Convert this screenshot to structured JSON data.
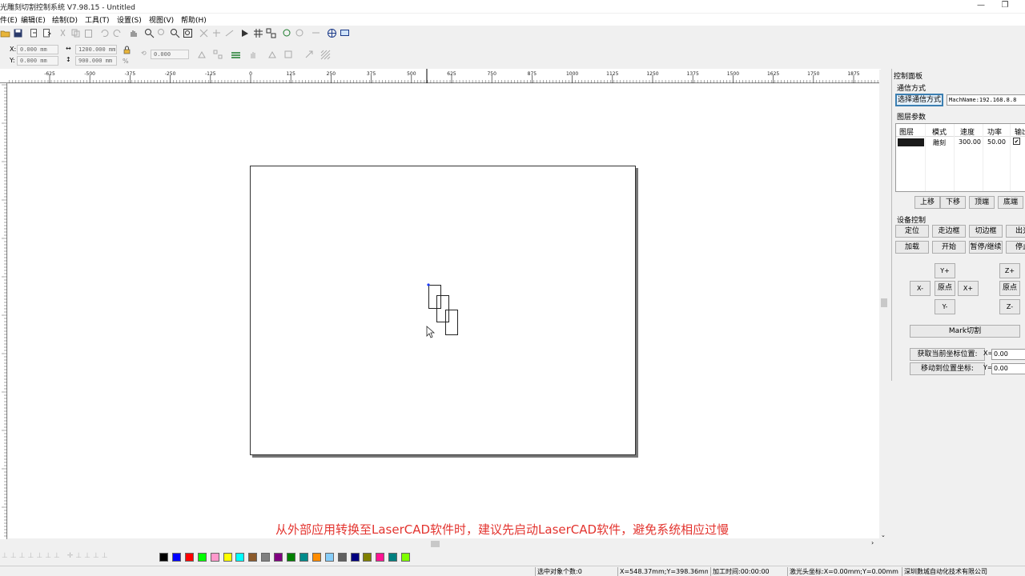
{
  "app": {
    "title": "光雕刻切割控制系统 V7.98.15 - Untitled",
    "win_minimize": "—",
    "win_restore": "❐"
  },
  "menu": [
    {
      "id": "file",
      "label": "件(E)"
    },
    {
      "id": "edit",
      "label": "编辑(E)"
    },
    {
      "id": "draw",
      "label": "绘制(D)"
    },
    {
      "id": "tools",
      "label": "工具(T)"
    },
    {
      "id": "settings",
      "label": "设置(S)"
    },
    {
      "id": "view",
      "label": "视图(V)"
    },
    {
      "id": "help",
      "label": "帮助(H)"
    }
  ],
  "properties": {
    "x_label": "X:",
    "x_value": "0.000 mm",
    "y_label": "Y:",
    "y_value": "0.000 mm",
    "width_value": "1200.000 mm",
    "height_value": "900.000 mm",
    "rotate_value": "0.000",
    "percent": "%"
  },
  "ruler": {
    "labels": [
      "-625",
      "-500",
      "-375",
      "-250",
      "-125",
      "0",
      "125",
      "250",
      "375",
      "500",
      "625",
      "750",
      "875",
      "1000",
      "1125",
      "1250",
      "1375",
      "1500",
      "1625",
      "1750",
      "1875"
    ]
  },
  "canvas": {
    "subtitle": "从外部应用转换至LaserCAD软件时，建议先启动LaserCAD软件，避免系统相应过慢"
  },
  "palette": {
    "colors": [
      "#000000",
      "#0000ff",
      "#ff0000",
      "#00ff00",
      "#ff99cc",
      "#ffff00",
      "#00ffff",
      "#8b5a2b",
      "#808080",
      "#800080",
      "#008000",
      "#008b8b",
      "#ff8c00",
      "#87cefa",
      "#606060",
      "#000080",
      "#808000",
      "#ff1493",
      "#008080",
      "#7fff00"
    ]
  },
  "status": {
    "selected_count": "选中对象个数:0",
    "cursor_pos": "X=548.37mm;Y=398.36mm",
    "process_time": "加工时间:00:00:00",
    "laser_pos": "激光头坐标:X=0.00mm;Y=0.00mm",
    "company": "深圳數城自动化技术有限公司"
  },
  "panel": {
    "title": "控制面板",
    "comm_section": "通信方式",
    "comm_button": "选择通信方式",
    "mach_name": "MachName:192.168.8.8",
    "layer_section": "图层参数",
    "layer_headers": [
      "图层",
      "模式",
      "速度",
      "功率",
      "输出"
    ],
    "layer_row": {
      "color": "#1a1a1a",
      "mode": "雕刻",
      "speed": "300.00",
      "power": "50.00",
      "output_checked": true,
      "check": "✔"
    },
    "layer_buttons": [
      "上移",
      "下移",
      "顶端",
      "底端"
    ],
    "device_section": "设备控制",
    "device_buttons_row1": [
      "定位",
      "走边框",
      "切边框",
      "出光"
    ],
    "device_buttons_row2": [
      "加载",
      "开始",
      "暂停/继续",
      "停止"
    ],
    "jog": {
      "y_plus": "Y+",
      "y_minus": "Y-",
      "x_minus": "X-",
      "x_plus": "X+",
      "origin": "原点",
      "z_plus": "Z+",
      "z_minus": "Z-",
      "z_origin": "原点"
    },
    "mark_cut": "Mark切割",
    "get_pos": "获取当前坐标位置:",
    "move_pos": "移动到位置坐标:",
    "x_label": "X=",
    "x_value": "0.00",
    "y_label": "Y=",
    "y_value": "0.00"
  }
}
